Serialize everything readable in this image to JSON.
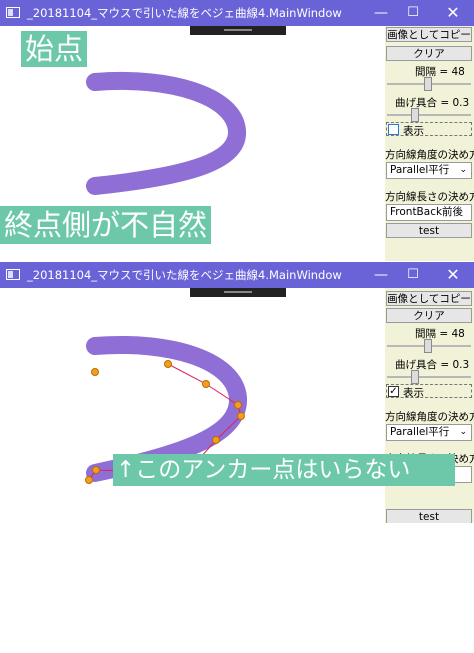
{
  "windows": [
    {
      "title": "_20181104_マウスで引いた線をベジェ曲線4.MainWindow",
      "controls": {
        "minimize": "—",
        "maximize": "☐",
        "close": "✕"
      },
      "panel": {
        "copy_button": "画像としてコピー",
        "clear_button": "クリア",
        "interval_label": "間隔 = 48",
        "interval_value": 48,
        "bend_label": "曲げ具合 = 0.3",
        "bend_value": 0.3,
        "show_label": "表示",
        "show_checked": false,
        "angle_label": "方向線角度の決め方",
        "angle_value": "Parallel平行",
        "length_label": "方向線長さの決め方",
        "length_value": "FrontBack前後",
        "test_button": "test"
      },
      "annotations": {
        "start": "始点",
        "end": "終点側が不自然"
      }
    },
    {
      "title": "_20181104_マウスで引いた線をベジェ曲線4.MainWindow",
      "controls": {
        "minimize": "—",
        "maximize": "☐",
        "close": "✕"
      },
      "panel": {
        "copy_button": "画像としてコピー",
        "clear_button": "クリア",
        "interval_label": "間隔 = 48",
        "interval_value": 48,
        "bend_label": "曲げ具合 = 0.3",
        "bend_value": 0.3,
        "show_label": "表示",
        "show_checked": true,
        "angle_label": "方向線角度の決め方",
        "angle_value": "Parallel平行",
        "length_label": "方向線長さの決め方",
        "test_button": "test"
      },
      "annotations": {
        "anchor_note": "↑このアンカー点はいらない"
      }
    }
  ],
  "colors": {
    "titlebar": "#6a63d8",
    "stroke": "#8f6fd6",
    "label_bg": "#6cc8a8",
    "panel_bg": "#f2f2d9",
    "anchor": "#f0a020",
    "guide": "#e0205a"
  }
}
